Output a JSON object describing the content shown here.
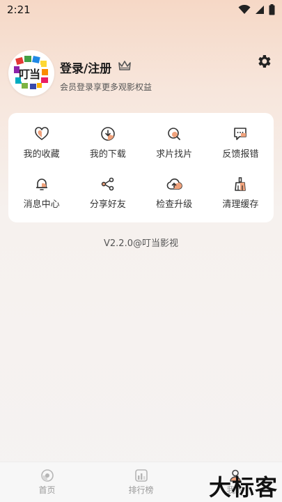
{
  "status": {
    "time": "2:21"
  },
  "profile": {
    "logo_text": "叮当",
    "title": "登录/注册",
    "subtitle": "会员登录享更多观影权益"
  },
  "menu": {
    "items": [
      {
        "label": "我的收藏",
        "icon": "heart-icon"
      },
      {
        "label": "我的下载",
        "icon": "download-icon"
      },
      {
        "label": "求片找片",
        "icon": "search-film-icon"
      },
      {
        "label": "反馈报错",
        "icon": "feedback-icon"
      },
      {
        "label": "消息中心",
        "icon": "bell-icon"
      },
      {
        "label": "分享好友",
        "icon": "share-icon"
      },
      {
        "label": "检查升级",
        "icon": "upgrade-icon"
      },
      {
        "label": "清理缓存",
        "icon": "broom-icon"
      }
    ]
  },
  "version": "V2.2.0@叮当影视",
  "nav": {
    "items": [
      {
        "label": "首页"
      },
      {
        "label": "排行榜"
      },
      {
        "label": "我的"
      }
    ]
  },
  "watermark": "大标客",
  "colors": {
    "accent": "#f0a27c",
    "icon_stroke": "#333333"
  }
}
